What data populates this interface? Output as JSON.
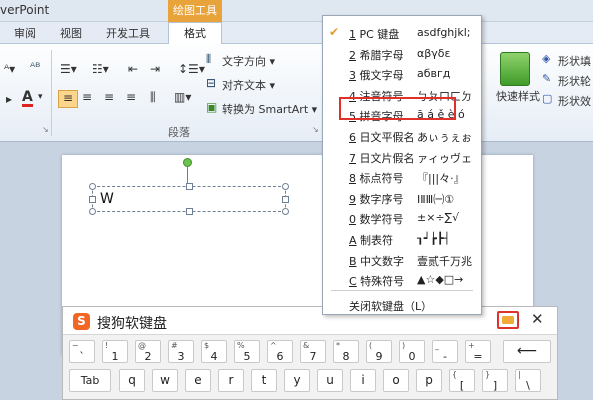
{
  "titlebar": {
    "app_title": "verPoint",
    "context_label": "绘图工具"
  },
  "tabs": [
    "审阅",
    "视图",
    "开发工具"
  ],
  "format_tab": "格式",
  "ribbon": {
    "text_direction": "文字方向 ▾",
    "align_text": "对齐文本 ▾",
    "convert_smartart": "转换为 SmartArt ▾",
    "group_label": "段落",
    "quick_styles": "快速样式",
    "shape_fill": "形状填",
    "shape_outline": "形状轮",
    "shape_effects": "形状效"
  },
  "slide": {
    "text": "W"
  },
  "menu": {
    "items": [
      {
        "num": "1",
        "name": "PC 键盘",
        "sample": "asdfghjkl;",
        "checked": true
      },
      {
        "num": "2",
        "name": "希腊字母",
        "sample": "αβγδε",
        "checked": false
      },
      {
        "num": "3",
        "name": "俄文字母",
        "sample": "абвгд",
        "checked": false
      },
      {
        "num": "4",
        "name": "注音符号",
        "sample": "ㄅㄆㄇㄈㄉ",
        "checked": false
      },
      {
        "num": "5",
        "name": "拼音字母",
        "sample": "ā á ě è ó",
        "checked": false
      },
      {
        "num": "6",
        "name": "日文平假名",
        "sample": "あぃぅぇぉ",
        "checked": false
      },
      {
        "num": "7",
        "name": "日文片假名",
        "sample": "ァィゥヴェ",
        "checked": false
      },
      {
        "num": "8",
        "name": "标点符号",
        "sample": "『|||々·』",
        "checked": false
      },
      {
        "num": "9",
        "name": "数字序号",
        "sample": "ⅠⅡⅢ㈠①",
        "checked": false
      },
      {
        "num": "0",
        "name": "数学符号",
        "sample": "±×÷∑√",
        "checked": false
      },
      {
        "num": "A",
        "name": "制表符",
        "sample": "┒┙┢┣┤",
        "checked": false
      },
      {
        "num": "B",
        "name": "中文数字",
        "sample": "壹贰千万兆",
        "checked": false
      },
      {
        "num": "C",
        "name": "特殊符号",
        "sample": "▲☆◆□→",
        "checked": false
      }
    ],
    "close_label": "关闭软键盘（L）"
  },
  "keyboard": {
    "title": "搜狗软键盘",
    "close_symbol": "✕",
    "row1": [
      {
        "up": "~",
        "dn": "`"
      },
      {
        "up": "!",
        "dn": "1"
      },
      {
        "up": "@",
        "dn": "2"
      },
      {
        "up": "#",
        "dn": "3"
      },
      {
        "up": "$",
        "dn": "4"
      },
      {
        "up": "%",
        "dn": "5"
      },
      {
        "up": "^",
        "dn": "6"
      },
      {
        "up": "&",
        "dn": "7"
      },
      {
        "up": "*",
        "dn": "8"
      },
      {
        "up": "(",
        "dn": "9"
      },
      {
        "up": ")",
        "dn": "0"
      },
      {
        "up": "_",
        "dn": "-"
      },
      {
        "up": "+",
        "dn": "="
      }
    ],
    "backspace": "⟵",
    "tab_label": "Tab",
    "row2": [
      "q",
      "w",
      "e",
      "r",
      "t",
      "y",
      "u",
      "i",
      "o",
      "p"
    ],
    "row2_sym": [
      {
        "up": "{",
        "dn": "["
      },
      {
        "up": "}",
        "dn": "]"
      },
      {
        "up": "|",
        "dn": "\\"
      }
    ]
  },
  "colors": {
    "accent": "#e9a33b",
    "highlight": "#e0302a",
    "sogou": "#f26522"
  }
}
